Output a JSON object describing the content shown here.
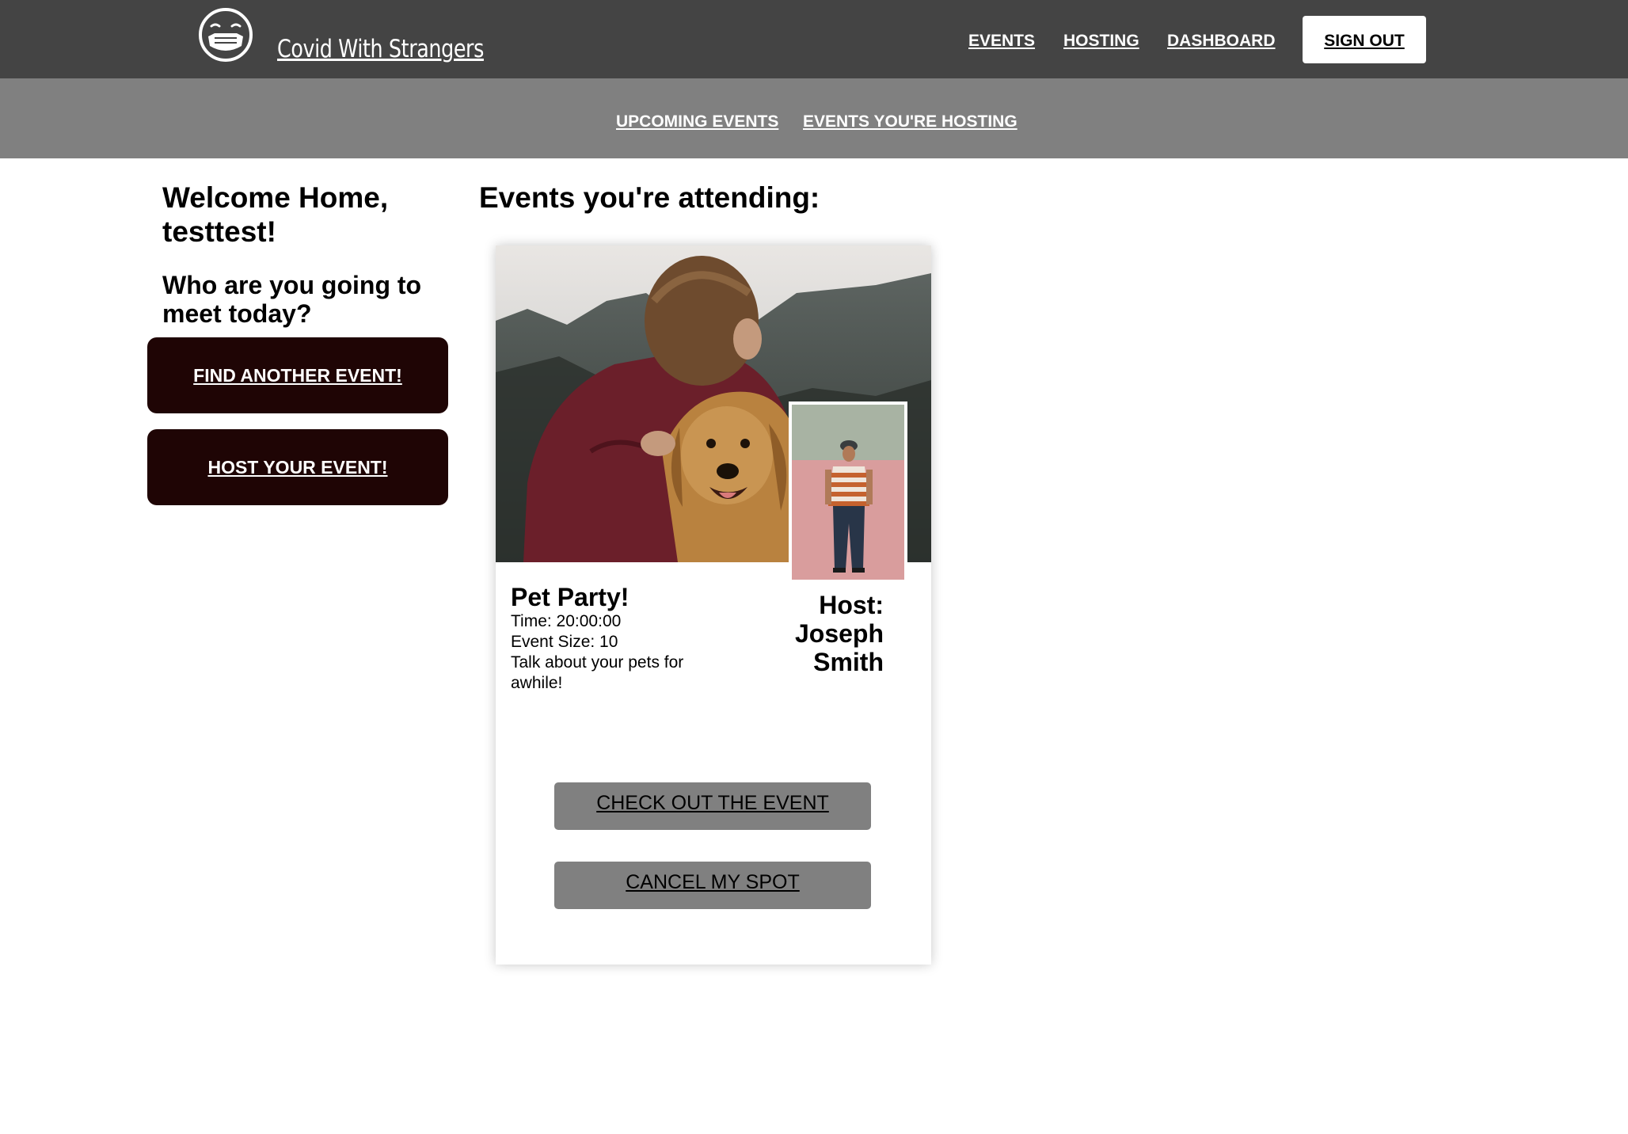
{
  "header": {
    "brand": "Covid With Strangers",
    "logo_icon": "masked-face-icon",
    "nav": {
      "events": "EVENTS",
      "hosting": "HOSTING",
      "dashboard": "DASHBOARD"
    },
    "sign_out": "SIGN OUT"
  },
  "subnav": {
    "upcoming": "UPCOMING EVENTS",
    "hosting": "EVENTS YOU'RE HOSTING"
  },
  "sidebar": {
    "welcome": "Welcome Home, testtest!",
    "prompt": "Who are you going to meet today?",
    "find_button": "FIND ANOTHER EVENT!",
    "host_button": "HOST YOUR EVENT!"
  },
  "main": {
    "title": "Events you're attending:",
    "event": {
      "name": "Pet Party!",
      "time": "Time: 20:00:00",
      "size": "Event Size: 10",
      "description": "Talk about your pets for awhile!",
      "host_label": "Host:",
      "host_name": "Joseph Smith",
      "checkout_button": "CHECK OUT THE EVENT",
      "cancel_button": "CANCEL MY SPOT"
    }
  },
  "colors": {
    "topbar": "#444444",
    "subbar": "#808080",
    "sidebar_button": "#1f0505",
    "card_button": "#808080"
  }
}
